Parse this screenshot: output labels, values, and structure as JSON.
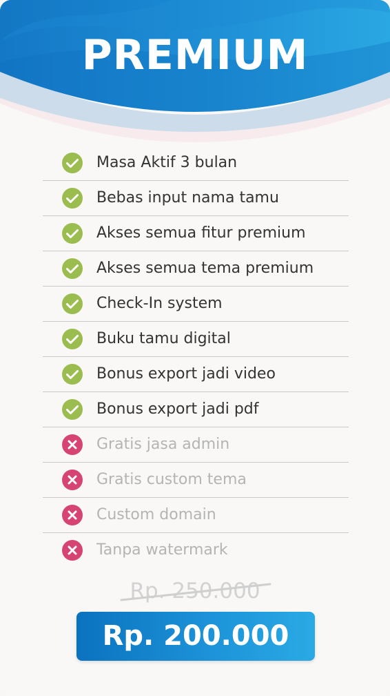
{
  "plan": {
    "title": "PREMIUM"
  },
  "features": [
    {
      "label": "Masa Aktif 3 bulan",
      "included": true,
      "icon": "check-circle-icon"
    },
    {
      "label": "Bebas input nama tamu",
      "included": true,
      "icon": "check-circle-icon"
    },
    {
      "label": "Akses semua fitur premium",
      "included": true,
      "icon": "check-circle-icon"
    },
    {
      "label": "Akses semua tema premium",
      "included": true,
      "icon": "check-circle-icon"
    },
    {
      "label": "Check-In system",
      "included": true,
      "icon": "check-circle-icon"
    },
    {
      "label": "Buku tamu digital",
      "included": true,
      "icon": "check-circle-icon"
    },
    {
      "label": "Bonus export jadi video",
      "included": true,
      "icon": "check-circle-icon"
    },
    {
      "label": "Bonus export jadi pdf",
      "included": true,
      "icon": "check-circle-icon"
    },
    {
      "label": "Gratis jasa admin",
      "included": false,
      "icon": "x-circle-icon"
    },
    {
      "label": "Gratis custom tema",
      "included": false,
      "icon": "x-circle-icon"
    },
    {
      "label": "Custom domain",
      "included": false,
      "icon": "x-circle-icon"
    },
    {
      "label": "Tanpa watermark",
      "included": false,
      "icon": "x-circle-icon"
    }
  ],
  "pricing": {
    "original_price": "Rp. 250.000",
    "price": "Rp. 200.000"
  },
  "colors": {
    "included_icon": "#9bbd50",
    "excluded_icon": "#d64473",
    "header_blue": "#1a8ad4",
    "header_light_blue": "#2ba8e3",
    "price_blue": "#0b72bf"
  }
}
